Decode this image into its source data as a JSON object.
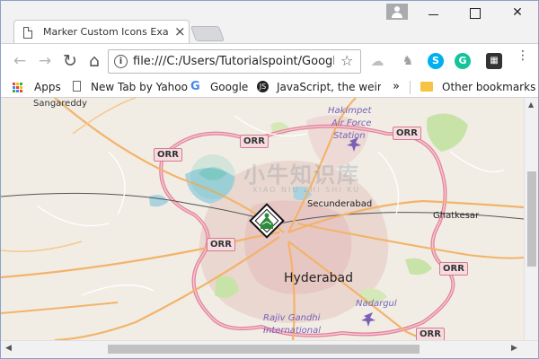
{
  "browser": {
    "tab_title": "Marker Custom Icons Exa",
    "tab_close": "×",
    "url": "file:///C:/Users/Tutorialspoint/Googl",
    "nav": {
      "back": "←",
      "forward": "→",
      "reload": "↻",
      "home": "⌂"
    },
    "window_controls": {
      "minimize": "",
      "maximize": "",
      "close": "✕"
    },
    "star": "☆",
    "menu": "⋮",
    "extensions": [
      {
        "icon": "cloud-icon",
        "color": "#bfbfbf",
        "glyph": "☁"
      },
      {
        "icon": "shield-icon",
        "color": "#9e9e9e",
        "glyph": "♞"
      },
      {
        "icon": "skype-icon",
        "color": "#00aff0",
        "glyph": "S"
      },
      {
        "icon": "grammarly-icon",
        "color": "#15c39a",
        "glyph": "G"
      },
      {
        "icon": "extension-icon",
        "color": "#333333",
        "glyph": "▦"
      }
    ]
  },
  "bookmarks": {
    "apps": "Apps",
    "items": [
      "New Tab by Yahoo",
      "Google",
      "JavaScript, the weird"
    ],
    "more": "»",
    "other": "Other bookmarks"
  },
  "map": {
    "places": {
      "sangareddy": "Sangareddy",
      "hakimpet": "Hakimpet",
      "air_force": "Air Force",
      "station": "Station",
      "secunderabad": "Secunderabad",
      "ghatkesar": "Ghatkesar",
      "hyderabad": "Hyderabad",
      "nadargul": "Nadargul",
      "rajiv_gandhi": "Rajiv Gandhi",
      "international": "International"
    },
    "orr_label": "ORR",
    "watermark": "小牛知识库",
    "watermark_sub": "XIAO NIU ZHI SHI KU"
  },
  "colors": {
    "map_bg": "#f1ede5",
    "orr_road": "#e2839b",
    "major_road": "#f3b36a",
    "urban": "#e7c9c6",
    "park": "#c8e3a8",
    "marker": "#2e8b3a"
  }
}
